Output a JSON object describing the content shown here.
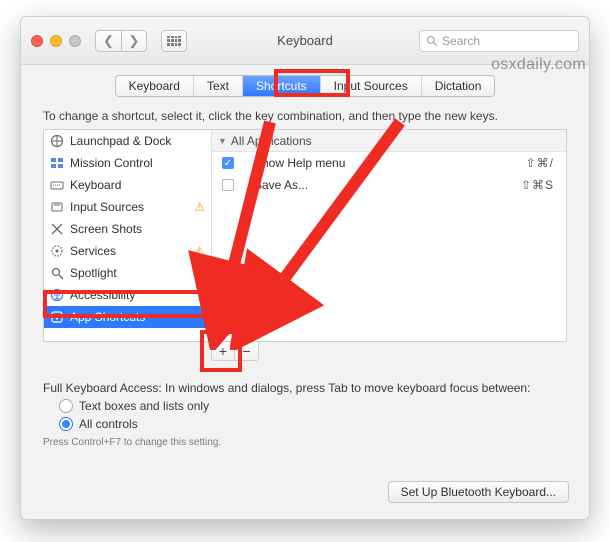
{
  "titlebar": {
    "title": "Keyboard",
    "search_placeholder": "Search"
  },
  "watermark": "osxdaily.com",
  "tabs": [
    "Keyboard",
    "Text",
    "Shortcuts",
    "Input Sources",
    "Dictation"
  ],
  "active_tab_index": 2,
  "instruction": "To change a shortcut, select it, click the key combination, and then type the new keys.",
  "categories": [
    {
      "label": "Launchpad & Dock",
      "icon": "launchpad",
      "warn": false
    },
    {
      "label": "Mission Control",
      "icon": "mission",
      "warn": false
    },
    {
      "label": "Keyboard",
      "icon": "keyboard",
      "warn": false
    },
    {
      "label": "Input Sources",
      "icon": "input",
      "warn": true
    },
    {
      "label": "Screen Shots",
      "icon": "screenshot",
      "warn": false
    },
    {
      "label": "Services",
      "icon": "services",
      "warn": true
    },
    {
      "label": "Spotlight",
      "icon": "spotlight",
      "warn": false
    },
    {
      "label": "Accessibility",
      "icon": "accessibility",
      "warn": false
    },
    {
      "label": "App Shortcuts",
      "icon": "app",
      "warn": false
    }
  ],
  "selected_category_index": 8,
  "group_header": "All Applications",
  "shortcuts": [
    {
      "enabled": true,
      "name": "Show Help menu",
      "keys": "⇧⌘/"
    },
    {
      "enabled": false,
      "name": "Save As...",
      "keys": "⇧⌘S"
    }
  ],
  "footer": {
    "title": "Full Keyboard Access: In windows and dialogs, press Tab to move keyboard focus between:",
    "opt_text": "Text boxes and lists only",
    "opt_all": "All controls",
    "selected": 1,
    "subhint": "Press Control+F7 to change this setting."
  },
  "bt_button": "Set Up Bluetooth Keyboard..."
}
